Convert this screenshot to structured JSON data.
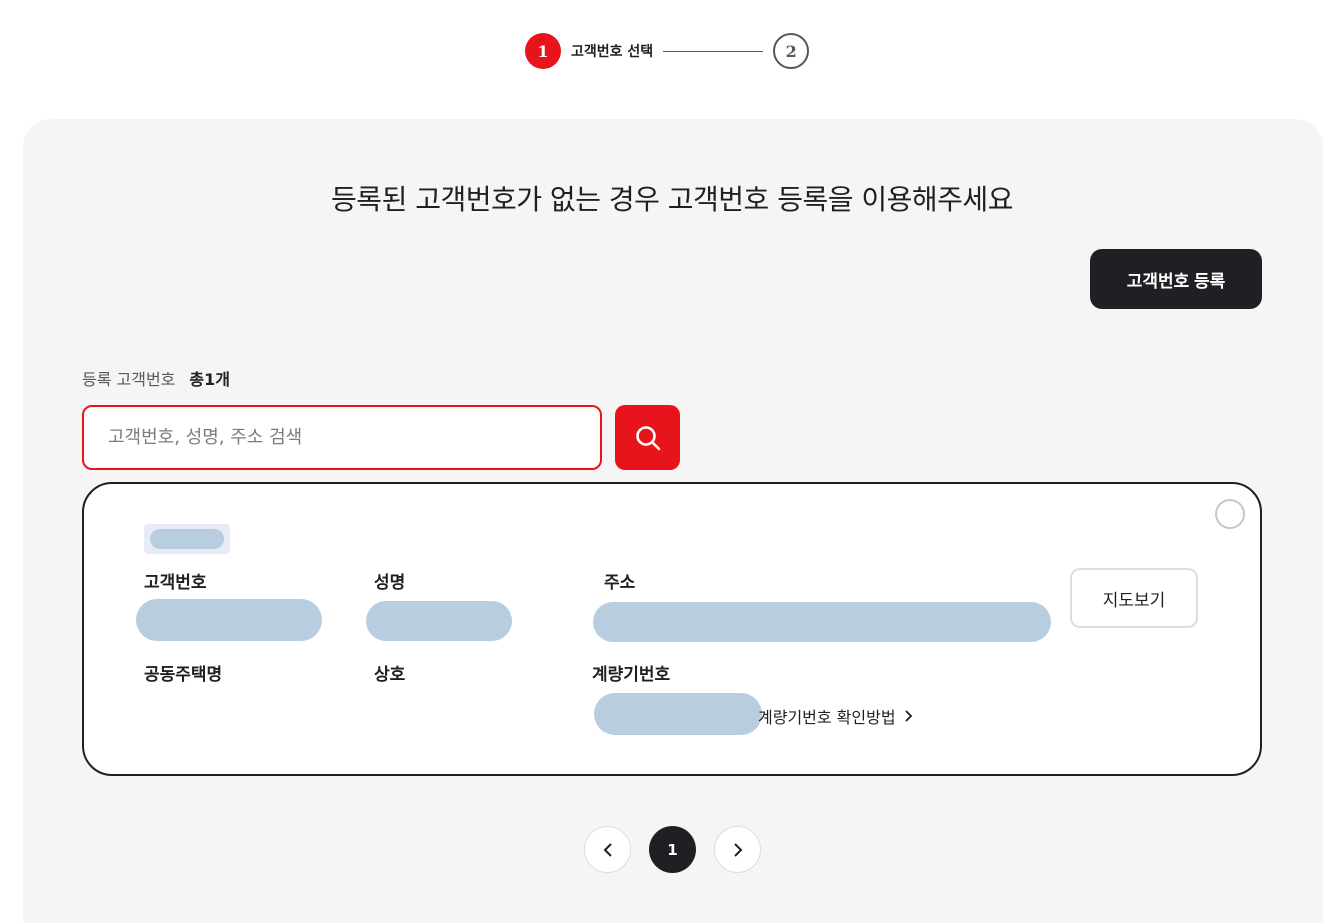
{
  "stepper": {
    "step1_number": "1",
    "step1_label": "고객번호 선택",
    "step2_number": "2"
  },
  "headline": "등록된 고객번호가 없는 경우 고객번호 등록을 이용해주세요",
  "register_button": "고객번호 등록",
  "count": {
    "label": "등록 고객번호",
    "value": "총1개"
  },
  "search": {
    "placeholder": "고객번호, 성명, 주소 검색",
    "button_icon": "search-icon"
  },
  "card": {
    "labels": {
      "customer_number": "고객번호",
      "name": "성명",
      "address": "주소",
      "apartment_name": "공동주택명",
      "business_name": "상호",
      "meter_number": "계량기번호"
    },
    "map_button": "지도보기",
    "meter_help_link": "계량기번호 확인방법"
  },
  "pagination": {
    "current_page": "1",
    "prev_icon": "chevron-left-icon",
    "next_icon": "chevron-right-icon"
  },
  "colors": {
    "accent_red": "#e8141b",
    "dark": "#1f2024",
    "panel_bg": "#f5f5f5",
    "redacted": "#b9cde0"
  }
}
